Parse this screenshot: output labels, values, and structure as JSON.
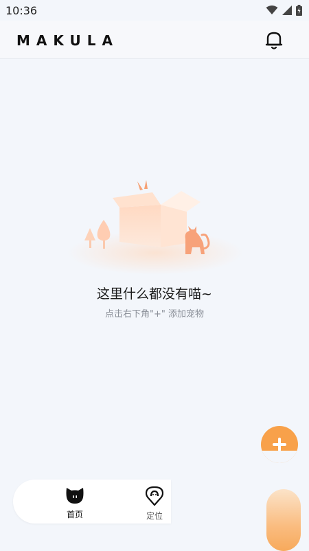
{
  "status_bar": {
    "time": "10:36"
  },
  "header": {
    "brand": "MAKULA"
  },
  "empty_state": {
    "title": "这里什么都没有喵~",
    "hint": "点击右下角\"+\" 添加宠物"
  },
  "tabs": [
    {
      "label": "首页",
      "icon": "cat-face-icon",
      "active": true
    },
    {
      "label": "定位",
      "icon": "location-pin-icon",
      "active": false
    }
  ],
  "colors": {
    "accent": "#f8a14a",
    "background": "#f3f6fb"
  }
}
